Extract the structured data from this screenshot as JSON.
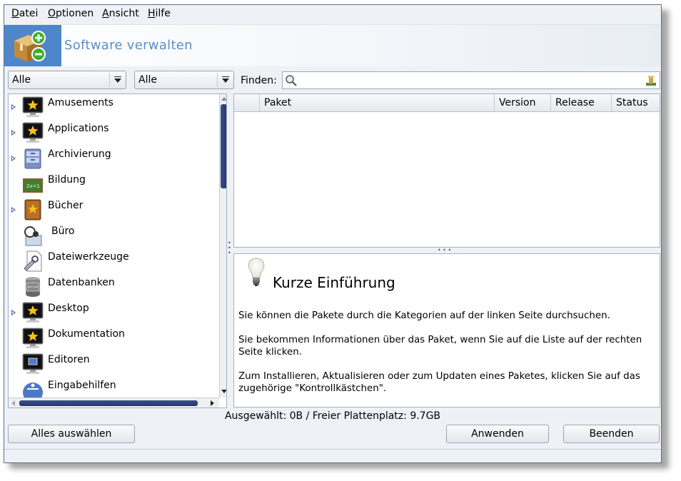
{
  "menu": [
    "Datei",
    "Optionen",
    "Ansicht",
    "Hilfe"
  ],
  "menu_mnemonics": [
    "D",
    "O",
    "A",
    "H"
  ],
  "banner": {
    "title": "Software verwalten"
  },
  "filters": {
    "left": "Alle",
    "right": "Alle"
  },
  "search": {
    "label": "Finden:",
    "value": ""
  },
  "categories": [
    {
      "label": "Amusements",
      "expandable": true,
      "icon": "monitor-star-icon"
    },
    {
      "label": "Applications",
      "expandable": true,
      "icon": "monitor-star-icon"
    },
    {
      "label": "Archivierung",
      "expandable": true,
      "icon": "file-cabinet-icon"
    },
    {
      "label": "Bildung",
      "expandable": false,
      "icon": "chalkboard-icon"
    },
    {
      "label": "Bücher",
      "expandable": true,
      "icon": "book-star-icon"
    },
    {
      "label": "Büro",
      "expandable": false,
      "icon": "office-icon"
    },
    {
      "label": "Dateiwerkzeuge",
      "expandable": false,
      "icon": "file-tools-icon"
    },
    {
      "label": "Datenbanken",
      "expandable": false,
      "icon": "database-icon"
    },
    {
      "label": "Desktop",
      "expandable": true,
      "icon": "monitor-star-icon"
    },
    {
      "label": "Dokumentation",
      "expandable": false,
      "icon": "monitor-star-icon"
    },
    {
      "label": "Editoren",
      "expandable": false,
      "icon": "monitor-icon"
    },
    {
      "label": "Eingabehilfen",
      "expandable": false,
      "icon": "accessibility-icon"
    }
  ],
  "package_columns": [
    "Paket",
    "Version",
    "Release",
    "Status"
  ],
  "info": {
    "title": "Kurze Einführung",
    "p1": "Sie können die Pakete durch die Kategorien auf der linken Seite durchsuchen.",
    "p2a": "Sie bekommen Informationen über das Paket, wenn Sie auf die Liste auf der rechten",
    "p2b": "Seite klicken.",
    "p3a": "Zum Installieren, Aktualisieren oder zum Updaten eines Paketes, klicken Sie auf das",
    "p3b": "zugehörige \"Kontrollkästchen\"."
  },
  "status_text": "Ausgewählt: 0B / Freier Plattenplatz: 9.7GB",
  "buttons": {
    "select_all": "Alles auswählen",
    "apply": "Anwenden",
    "quit": "Beenden"
  },
  "colors": {
    "banner_title": "#5b8fc8",
    "scroll_thumb": "#2c3d78",
    "banner_icon_bg": "#4f86c9"
  }
}
